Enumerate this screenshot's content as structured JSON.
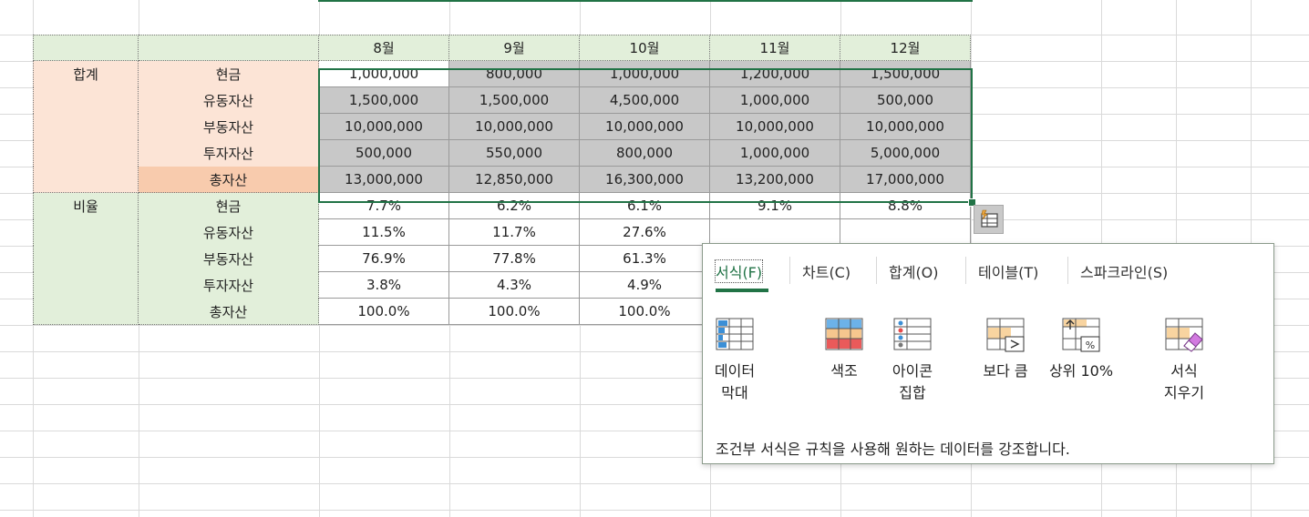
{
  "months": [
    "8월",
    "9월",
    "10월",
    "11월",
    "12월"
  ],
  "groups": [
    {
      "label": "합계",
      "rows": [
        {
          "label": "현금",
          "values": [
            "1,000,000",
            "800,000",
            "1,000,000",
            "1,200,000",
            "1,500,000"
          ]
        },
        {
          "label": "유동자산",
          "values": [
            "1,500,000",
            "1,500,000",
            "4,500,000",
            "1,000,000",
            "500,000"
          ]
        },
        {
          "label": "부동자산",
          "values": [
            "10,000,000",
            "10,000,000",
            "10,000,000",
            "10,000,000",
            "10,000,000"
          ]
        },
        {
          "label": "투자자산",
          "values": [
            "500,000",
            "550,000",
            "800,000",
            "1,000,000",
            "5,000,000"
          ]
        },
        {
          "label": "총자산",
          "values": [
            "13,000,000",
            "12,850,000",
            "16,300,000",
            "13,200,000",
            "17,000,000"
          ]
        }
      ]
    },
    {
      "label": "비율",
      "rows": [
        {
          "label": "현금",
          "values": [
            "7.7%",
            "6.2%",
            "6.1%",
            "9.1%",
            "8.8%"
          ]
        },
        {
          "label": "유동자산",
          "values": [
            "11.5%",
            "11.7%",
            "27.6%",
            "",
            ""
          ]
        },
        {
          "label": "부동자산",
          "values": [
            "76.9%",
            "77.8%",
            "61.3%",
            "",
            ""
          ]
        },
        {
          "label": "투자자산",
          "values": [
            "3.8%",
            "4.3%",
            "4.9%",
            "",
            ""
          ]
        },
        {
          "label": "총자산",
          "values": [
            "100.0%",
            "100.0%",
            "100.0%",
            "",
            ""
          ]
        }
      ]
    }
  ],
  "quick_analysis": {
    "button_icon": "quick-analysis-icon",
    "tabs": [
      "서식(F)",
      "차트(C)",
      "합계(O)",
      "테이블(T)",
      "스파크라인(S)"
    ],
    "active_tab": "서식(F)",
    "tools": [
      {
        "label": "데이터\n막대",
        "icon": "data-bar-icon"
      },
      {
        "label": "색조",
        "icon": "color-scale-icon"
      },
      {
        "label": "아이콘\n집합",
        "icon": "icon-set-icon"
      },
      {
        "label": "보다 큼",
        "icon": "greater-than-icon"
      },
      {
        "label": "상위 10%",
        "icon": "top-10-percent-icon"
      },
      {
        "label": "서식\n지우기",
        "icon": "clear-format-icon"
      }
    ],
    "description": "조건부 서식은 규칙을 사용해 원하는 데이터를 강조합니다."
  },
  "colors": {
    "header_green": "#e2efda",
    "group_peach": "#fce4d6",
    "total_peach": "#f8cbad",
    "selection_gray": "#c8c8c8",
    "accent": "#217346"
  }
}
